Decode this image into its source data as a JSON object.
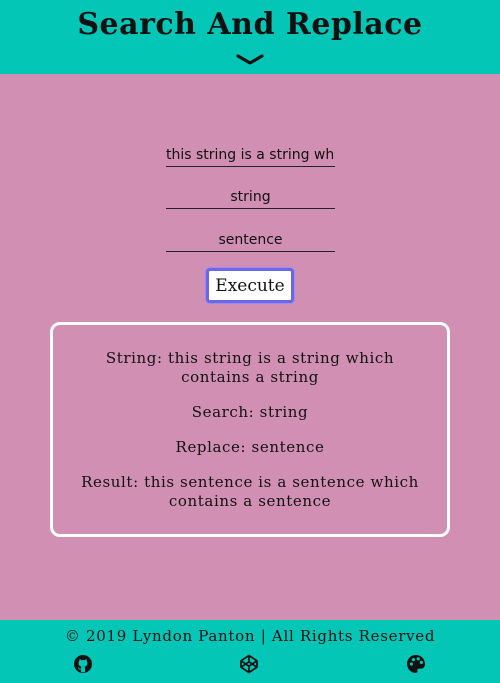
{
  "header": {
    "title": "Search And Replace",
    "toggle_icon": "chevron-down-icon"
  },
  "form": {
    "string_value": "this string is a string which contains a string",
    "search_value": "string",
    "replace_value": "sentence",
    "execute_label": "Execute"
  },
  "result": {
    "string_line": "String: this string is a string which contains a string",
    "search_line": "Search: string",
    "replace_line": "Replace: sentence",
    "result_line": "Result: this sentence is a sentence which contains a sentence"
  },
  "footer": {
    "copyright": "© 2019 Lyndon Panton | All Rights Reserved",
    "icons": [
      "github-icon",
      "codepen-icon",
      "palette-icon"
    ]
  },
  "colors": {
    "header_bg": "#03c6b6",
    "page_bg": "#d08fb3",
    "button_border": "#6a67e8",
    "box_border": "#ffffff"
  }
}
